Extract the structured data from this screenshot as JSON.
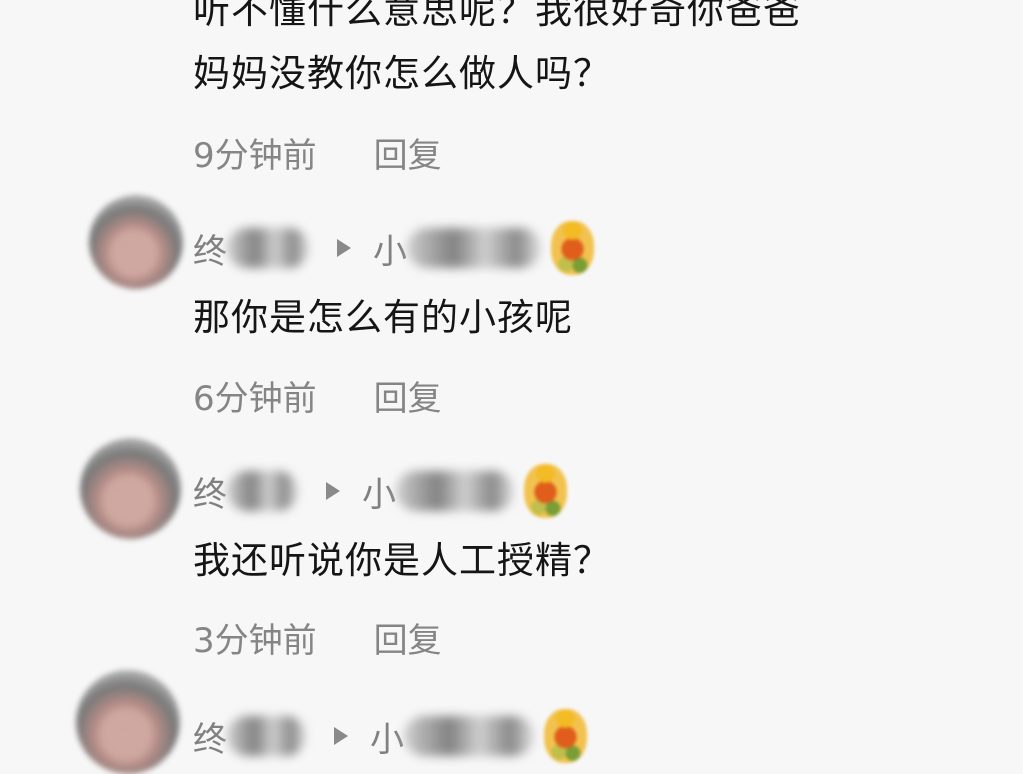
{
  "comments": [
    {
      "text_lines": [
        "听不懂什么意思呢？我很好奇你爸爸",
        "妈妈没教你怎么做人吗？"
      ],
      "time": "9分钟前",
      "reply_label": "回复"
    },
    {
      "author_prefix": "终",
      "reply_to_prefix": "小",
      "text": "那你是怎么有的小孩呢",
      "time": "6分钟前",
      "reply_label": "回复"
    },
    {
      "author_prefix": "终",
      "reply_to_prefix": "小",
      "text": "我还听说你是人工授精？",
      "time": "3分钟前",
      "reply_label": "回复"
    },
    {
      "author_prefix": "终",
      "reply_to_prefix": "小"
    }
  ],
  "icons": {
    "reply_arrow": "play-arrow-icon",
    "badge": "emoji-badge-icon"
  },
  "colors": {
    "background": "#f7f7f7",
    "text": "#151515",
    "meta": "#858585",
    "name": "#808080"
  }
}
